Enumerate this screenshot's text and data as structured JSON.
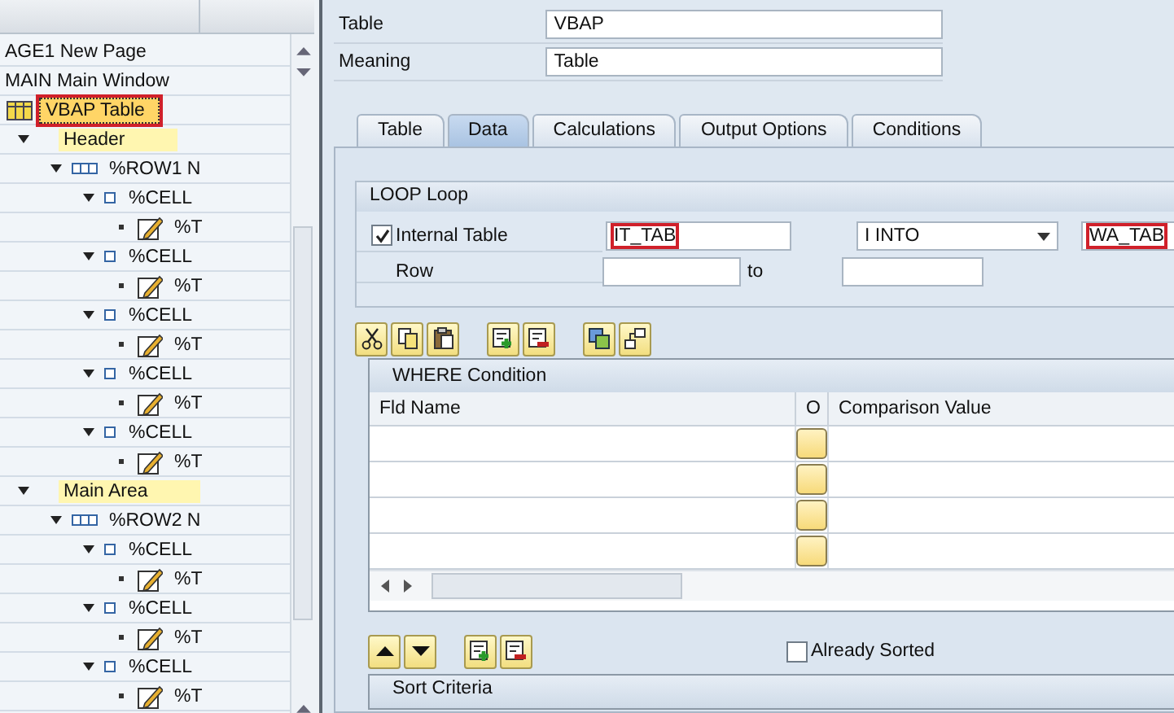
{
  "tree": {
    "nodes": [
      {
        "label": "AGE1 New Page",
        "selected": false,
        "children": [
          {
            "label": "MAIN Main Window",
            "selected": false,
            "children": [
              {
                "label": "VBAP Table",
                "kind": "table",
                "selected": true,
                "annotated": true,
                "children": [
                  {
                    "label": "Header",
                    "kind": "area",
                    "selected": false,
                    "expanded": true,
                    "children": [
                      {
                        "label": "%ROW1 N",
                        "kind": "row",
                        "selected": false,
                        "expanded": true,
                        "children": [
                          {
                            "label": "%CELL",
                            "kind": "cell",
                            "selected": false,
                            "expanded": true,
                            "children": [
                              {
                                "label": "%T",
                                "kind": "text",
                                "selected": false
                              }
                            ]
                          },
                          {
                            "label": "%CELL",
                            "kind": "cell",
                            "selected": false,
                            "expanded": true,
                            "children": [
                              {
                                "label": "%T",
                                "kind": "text",
                                "selected": false
                              }
                            ]
                          },
                          {
                            "label": "%CELL",
                            "kind": "cell",
                            "selected": false,
                            "expanded": true,
                            "children": [
                              {
                                "label": "%T",
                                "kind": "text",
                                "selected": false
                              }
                            ]
                          },
                          {
                            "label": "%CELL",
                            "kind": "cell",
                            "selected": false,
                            "expanded": true,
                            "children": [
                              {
                                "label": "%T",
                                "kind": "text",
                                "selected": false
                              }
                            ]
                          },
                          {
                            "label": "%CELL",
                            "kind": "cell",
                            "selected": false,
                            "expanded": true,
                            "children": [
                              {
                                "label": "%T",
                                "kind": "text",
                                "selected": false
                              }
                            ]
                          }
                        ]
                      }
                    ]
                  },
                  {
                    "label": "Main Area",
                    "kind": "area",
                    "selected": false,
                    "expanded": true,
                    "children": [
                      {
                        "label": "%ROW2 N",
                        "kind": "row",
                        "selected": false,
                        "expanded": true,
                        "children": [
                          {
                            "label": "%CELL",
                            "kind": "cell",
                            "selected": false,
                            "expanded": true,
                            "children": [
                              {
                                "label": "%T",
                                "kind": "text",
                                "selected": false
                              }
                            ]
                          },
                          {
                            "label": "%CELL",
                            "kind": "cell",
                            "selected": false,
                            "expanded": true,
                            "children": [
                              {
                                "label": "%T",
                                "kind": "text",
                                "selected": false
                              }
                            ]
                          },
                          {
                            "label": "%CELL",
                            "kind": "cell",
                            "selected": false,
                            "expanded": true,
                            "children": [
                              {
                                "label": "%T",
                                "kind": "text",
                                "selected": false
                              }
                            ]
                          }
                        ]
                      }
                    ]
                  }
                ]
              }
            ]
          }
        ]
      }
    ]
  },
  "header_fields": [
    {
      "label": "Table",
      "value": "VBAP"
    },
    {
      "label": "Meaning",
      "value": "Table"
    }
  ],
  "tabs": [
    {
      "label": "Table",
      "selected": false
    },
    {
      "label": "Data",
      "selected": true
    },
    {
      "label": "Calculations",
      "selected": false
    },
    {
      "label": "Output Options",
      "selected": false
    },
    {
      "label": "Conditions",
      "selected": false
    }
  ],
  "loop": {
    "title": "LOOP Loop",
    "internal_table": {
      "label": "Internal Table",
      "checked": true,
      "value": "IT_TAB",
      "annotated": true
    },
    "mode": {
      "value": "I INTO"
    },
    "target": {
      "value": "WA_TAB",
      "annotated": true
    },
    "row": {
      "label": "Row",
      "to_label": "to"
    }
  },
  "where_table": {
    "title": "WHERE Condition",
    "columns": [
      "Fld Name",
      "O",
      "Comparison Value"
    ]
  },
  "sort": {
    "already_sorted": {
      "label": "Already Sorted",
      "checked": false
    },
    "title": "Sort Criteria"
  }
}
